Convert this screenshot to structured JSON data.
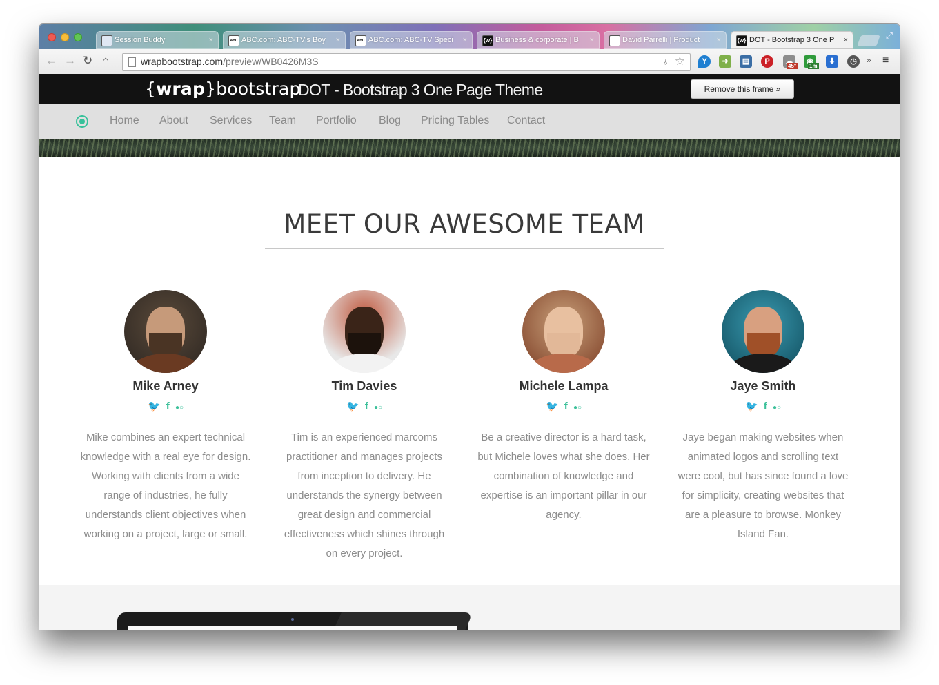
{
  "browser": {
    "tabs": [
      {
        "title": "Session Buddy",
        "favicon": "session-buddy-icon",
        "close": "×",
        "active": false
      },
      {
        "title": "ABC.com: ABC-TV's Boy",
        "favicon": "abc-icon",
        "close": "×",
        "active": false
      },
      {
        "title": "ABC.com: ABC-TV Speci",
        "favicon": "abc-icon",
        "close": "×",
        "active": false
      },
      {
        "title": "Business & corporate | B",
        "favicon": "wrap-icon",
        "close": "×",
        "active": false
      },
      {
        "title": "David Parrelli | Product",
        "favicon": "page-icon",
        "close": "×",
        "active": false
      },
      {
        "title": "DOT - Bootstrap 3 One P",
        "favicon": "wrap-icon",
        "close": "×",
        "active": true
      }
    ],
    "favicon_text": {
      "wrap": "{w}",
      "abc": "ABC"
    },
    "url_domain": "wrapbootstrap.com",
    "url_path": "/preview/WB0426M3S",
    "extension_badges": [
      "45°",
      "1m"
    ]
  },
  "wrapbar": {
    "logo_brace_open": "{",
    "logo_bold": "wrap",
    "logo_brace_close": "}",
    "logo_rest": "bootstrap",
    "theme_title": "DOT - Bootstrap 3 One Page Theme",
    "remove_label": "Remove this frame »"
  },
  "site_nav": {
    "items": [
      "Home",
      "About",
      "Services",
      "Team",
      "Portfolio",
      "Blog",
      "Pricing Tables",
      "Contact"
    ]
  },
  "team": {
    "title": "MEET OUR AWESOME TEAM",
    "accent_color": "#3cc09a",
    "members": [
      {
        "name": "Mike Arney",
        "bio": "Mike combines an expert technical knowledge with a real eye for design. Working with clients from a wide range of industries, he fully understands client objectives when working on a project, large or small."
      },
      {
        "name": "Tim Davies",
        "bio": "Tim is an experienced marcoms practitioner and manages projects from inception to delivery. He understands the synergy between great design and commercial effectiveness which shines through on every project."
      },
      {
        "name": "Michele Lampa",
        "bio": "Be a creative director is a hard task, but Michele loves what she does. Her combination of knowledge and expertise is an important pillar in our agency."
      },
      {
        "name": "Jaye Smith",
        "bio": "Jaye began making websites when animated logos and scrolling text were cool, but has since found a love for simplicity, creating websites that are a pleasure to browse. Monkey Island Fan."
      }
    ],
    "social_icons": [
      "twitter-icon",
      "facebook-icon",
      "flickr-icon"
    ],
    "social_glyphs": {
      "twitter": "🐦",
      "facebook": "f",
      "flickr": "●○"
    }
  }
}
